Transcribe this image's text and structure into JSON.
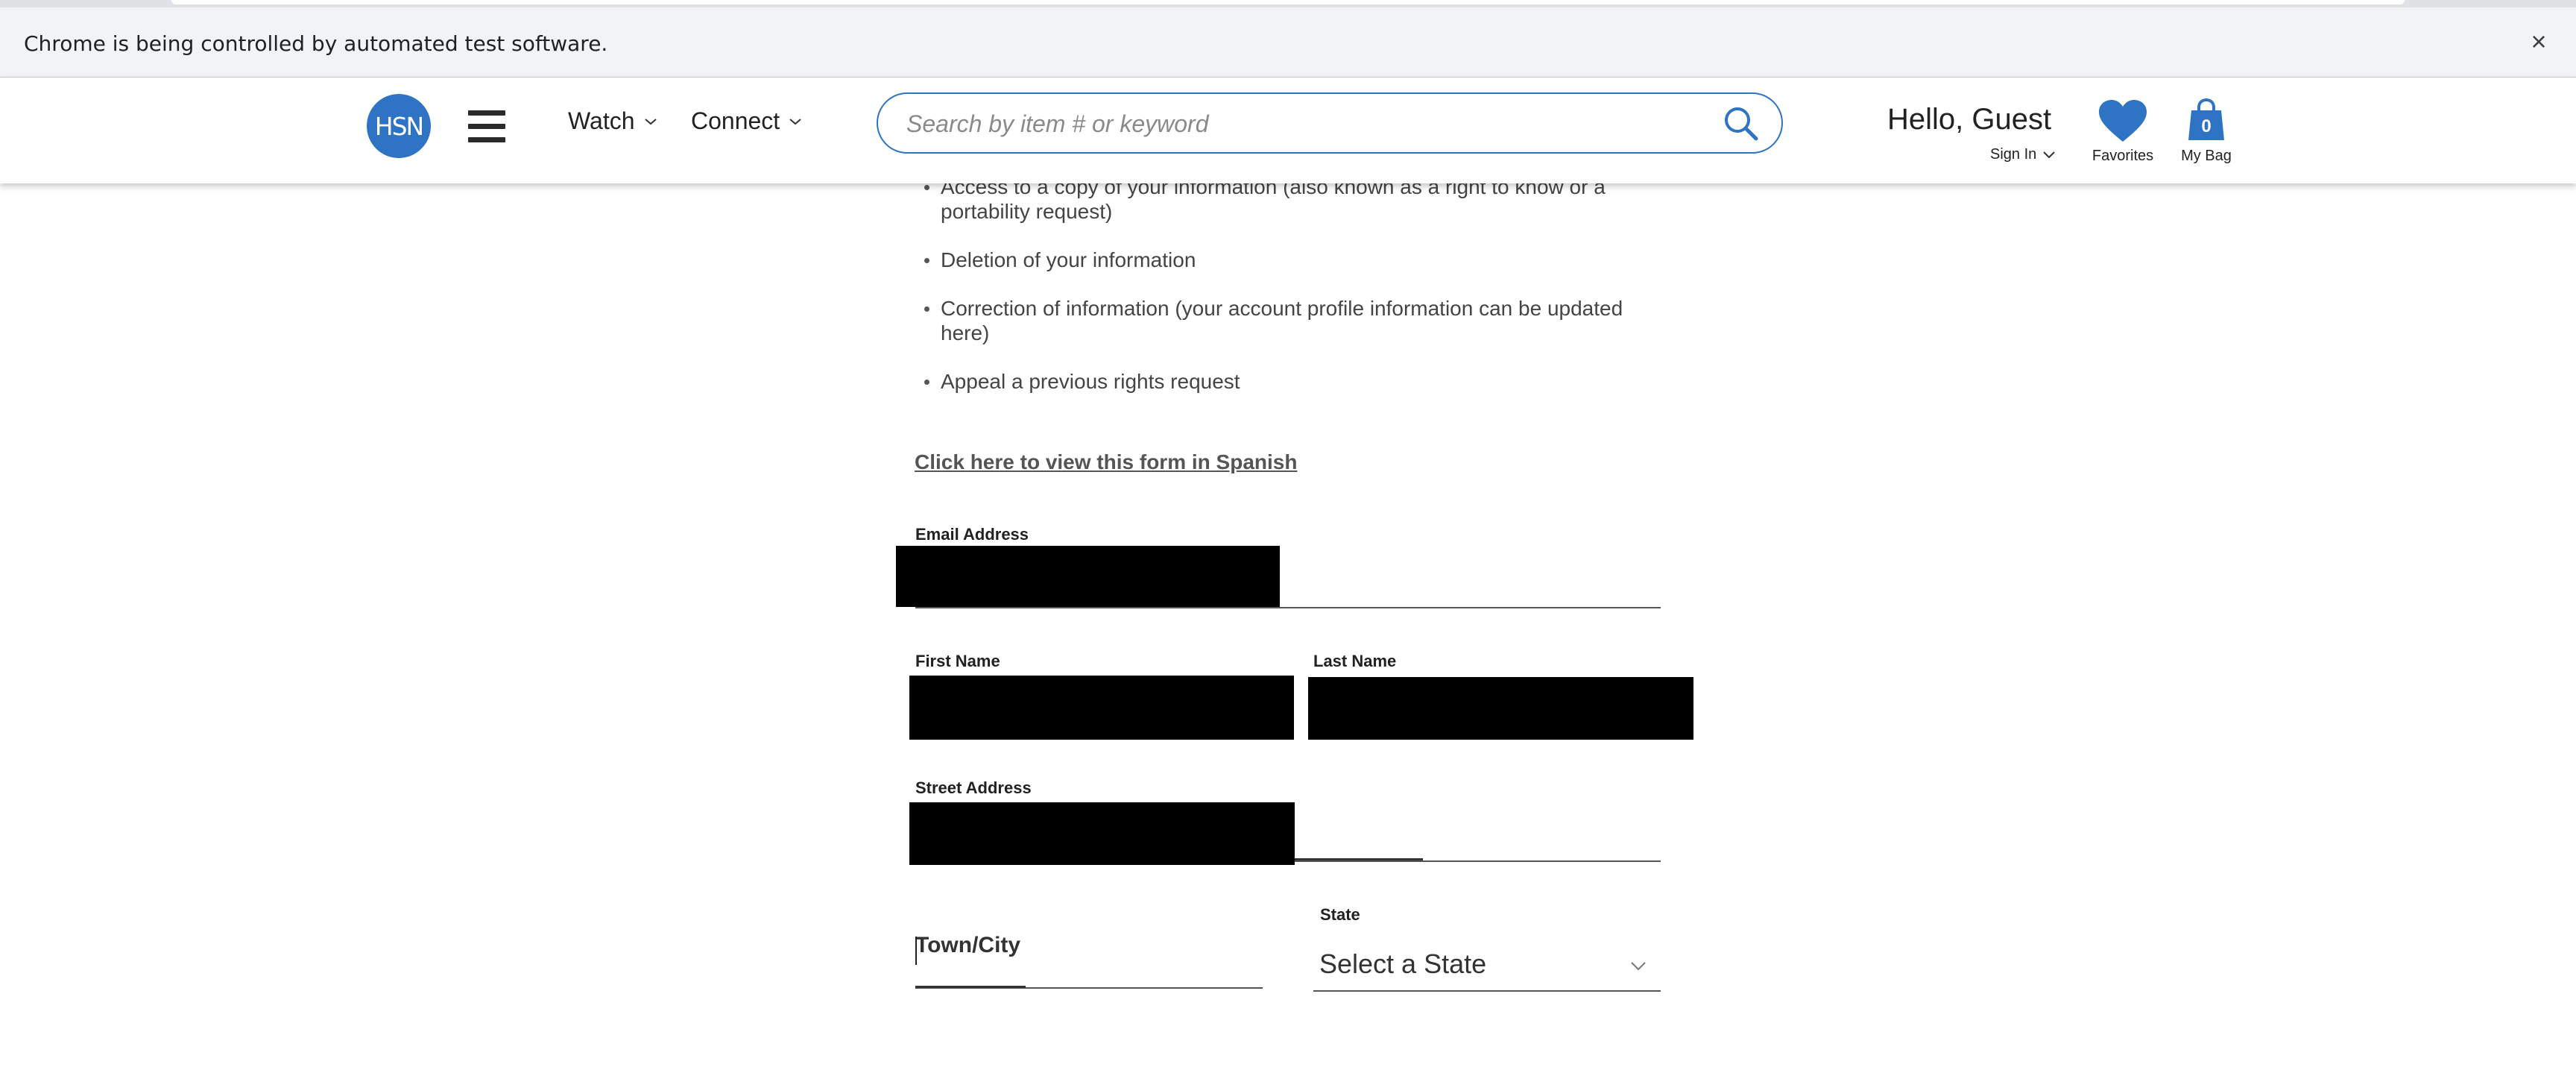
{
  "browser": {
    "infobar_text": "Chrome is being controlled by automated test software.",
    "close_glyph": "×"
  },
  "header": {
    "logo_text": "HSN",
    "nav": [
      {
        "label": "Watch",
        "icon": "chevron-down-icon"
      },
      {
        "label": "Connect",
        "icon": "chevron-down-icon"
      }
    ],
    "search": {
      "placeholder": "Search by item # or keyword",
      "value": "",
      "icon": "search-icon"
    },
    "greeting": "Hello, Guest",
    "sign_in_label": "Sign In",
    "favorites_label": "Favorites",
    "bag": {
      "label": "My Bag",
      "count": "0"
    },
    "accent_color": "#2e73c4"
  },
  "main": {
    "rights_list": [
      "Access to a copy of your information (also known as a right to know or a portability request)",
      "Deletion of your information",
      "Correction of information (your account profile information can be updated here)",
      "Appeal a previous rights request"
    ],
    "spanish_link": "Click here to view this form in Spanish",
    "form": {
      "email_label": "Email Address",
      "first_name_label": "First Name",
      "last_name_label": "Last Name",
      "street_label": "Street Address",
      "town_label": "Town/City",
      "state_label": "State",
      "state_value": "Select a State"
    }
  }
}
